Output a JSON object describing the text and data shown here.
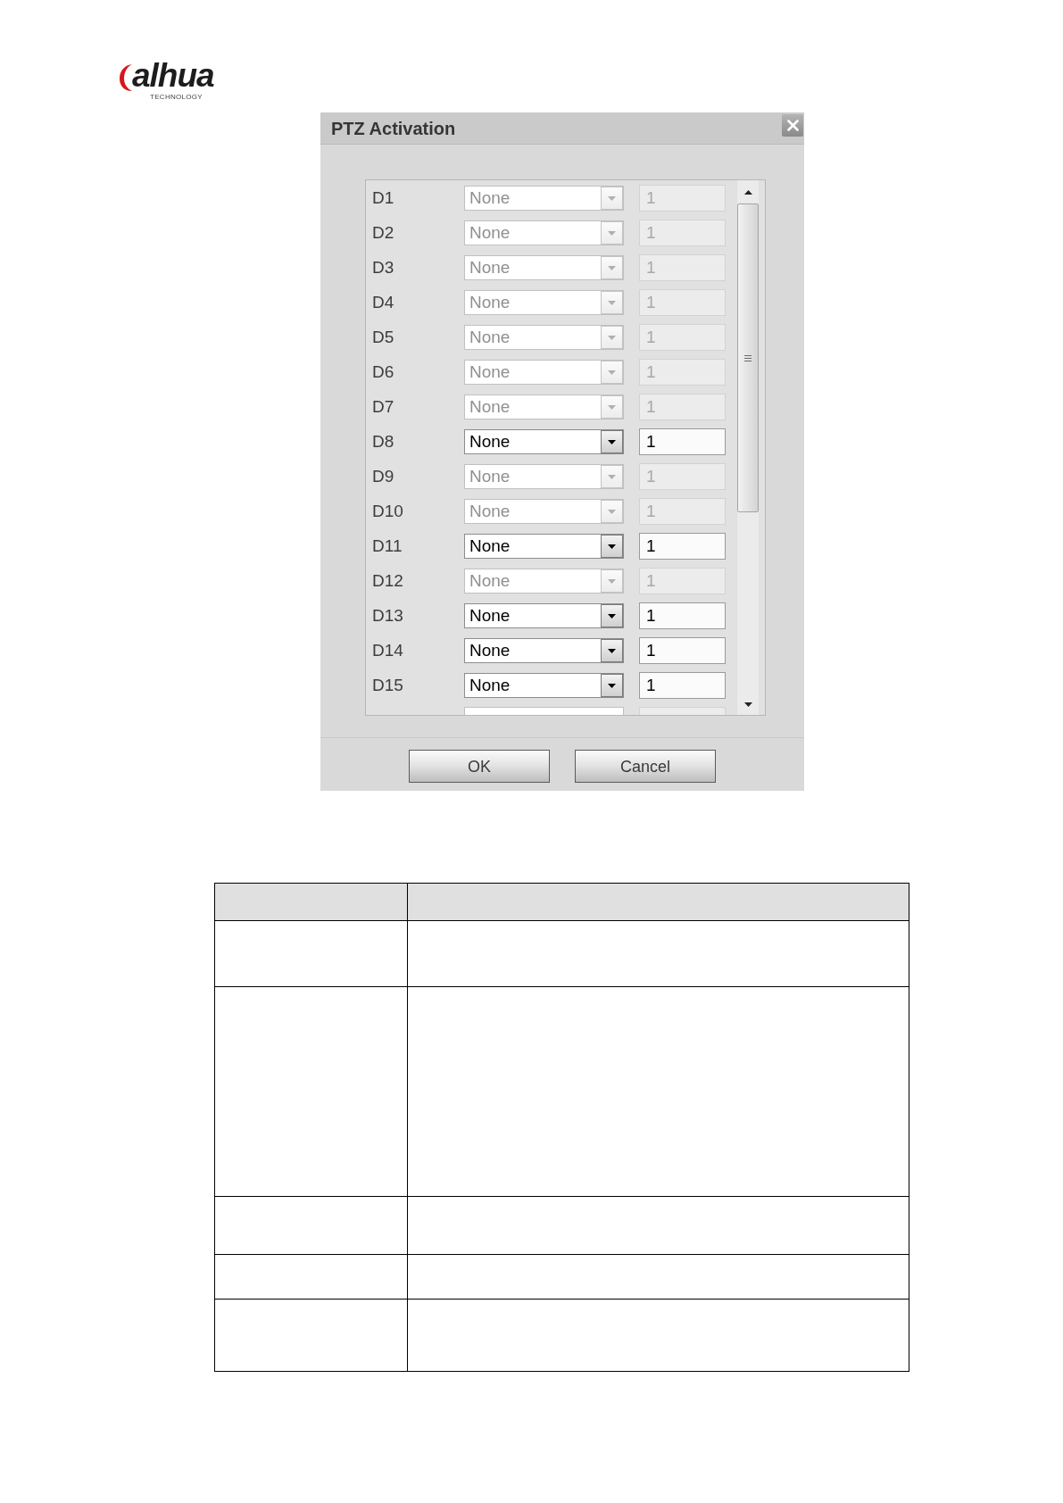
{
  "logo": {
    "wordmark": "alhua",
    "tagline": "TECHNOLOGY"
  },
  "dialog": {
    "title": "PTZ Activation",
    "rows": [
      {
        "label": "D1",
        "option": "None",
        "number": "1",
        "enabled": false
      },
      {
        "label": "D2",
        "option": "None",
        "number": "1",
        "enabled": false
      },
      {
        "label": "D3",
        "option": "None",
        "number": "1",
        "enabled": false
      },
      {
        "label": "D4",
        "option": "None",
        "number": "1",
        "enabled": false
      },
      {
        "label": "D5",
        "option": "None",
        "number": "1",
        "enabled": false
      },
      {
        "label": "D6",
        "option": "None",
        "number": "1",
        "enabled": false
      },
      {
        "label": "D7",
        "option": "None",
        "number": "1",
        "enabled": false
      },
      {
        "label": "D8",
        "option": "None",
        "number": "1",
        "enabled": true
      },
      {
        "label": "D9",
        "option": "None",
        "number": "1",
        "enabled": false
      },
      {
        "label": "D10",
        "option": "None",
        "number": "1",
        "enabled": false
      },
      {
        "label": "D11",
        "option": "None",
        "number": "1",
        "enabled": true
      },
      {
        "label": "D12",
        "option": "None",
        "number": "1",
        "enabled": false
      },
      {
        "label": "D13",
        "option": "None",
        "number": "1",
        "enabled": true
      },
      {
        "label": "D14",
        "option": "None",
        "number": "1",
        "enabled": true
      },
      {
        "label": "D15",
        "option": "None",
        "number": "1",
        "enabled": true
      }
    ],
    "partial_row": {
      "enabled": false
    },
    "buttons": [
      "OK",
      "Cancel"
    ]
  },
  "table": {
    "rows": [
      {
        "kind": "header"
      },
      {
        "kind": "body"
      },
      {
        "kind": "body"
      },
      {
        "kind": "body"
      },
      {
        "kind": "body"
      },
      {
        "kind": "body"
      }
    ]
  }
}
